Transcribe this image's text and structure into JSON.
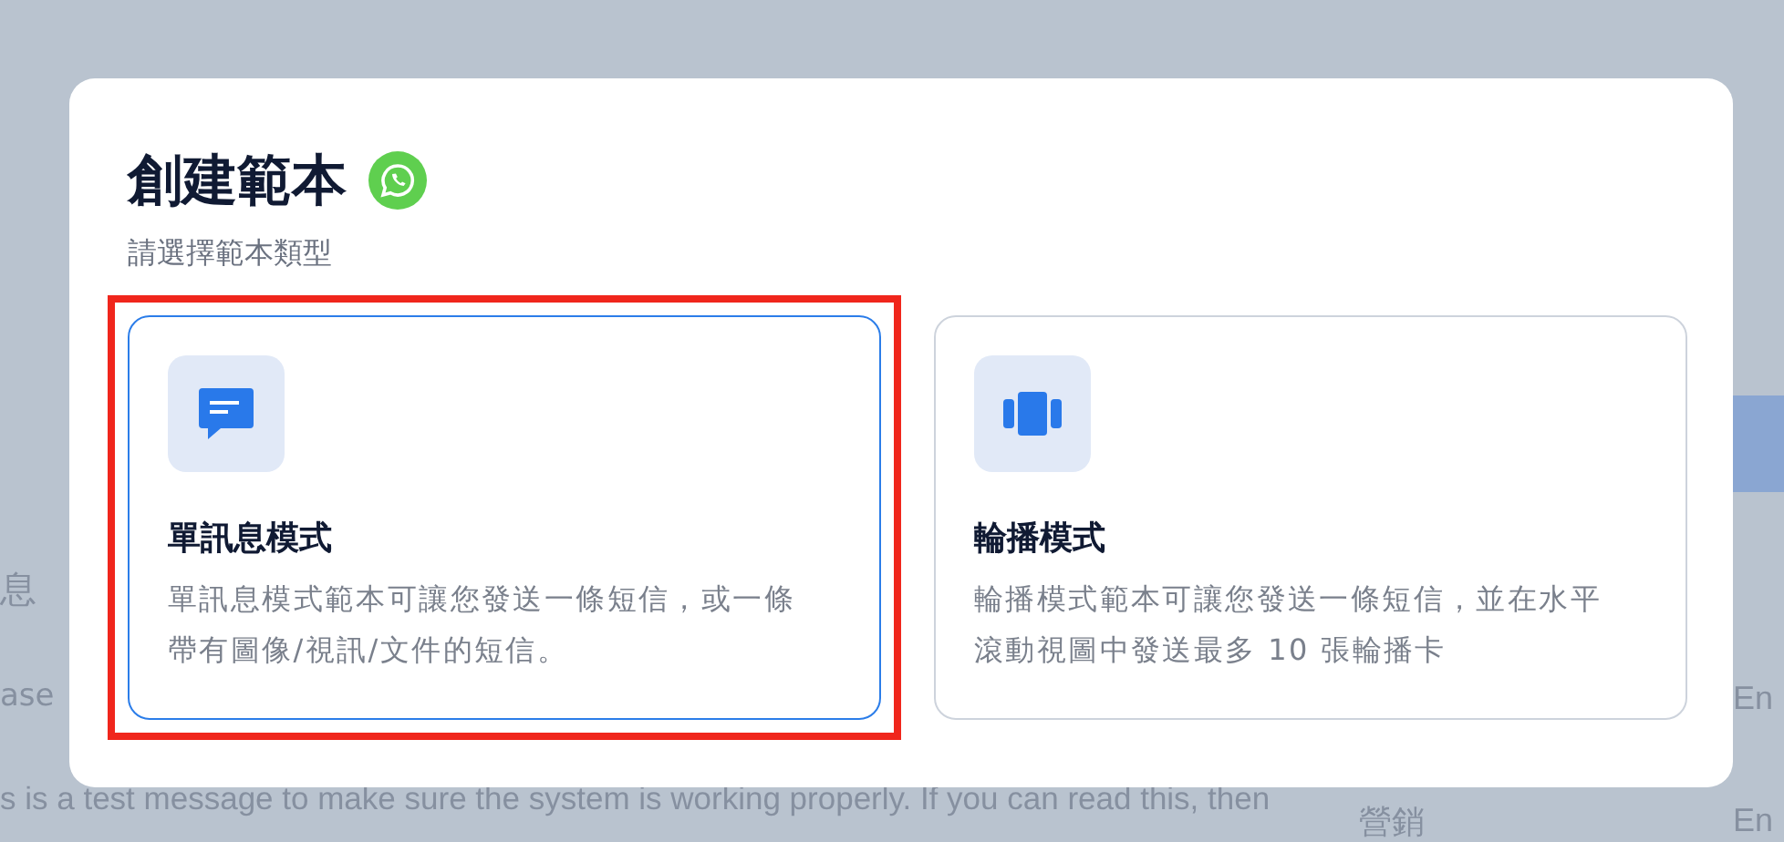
{
  "background": {
    "left_texts": [
      "息",
      "ase",
      "s is a test message to make sure the system is working properly. If you can read this, then"
    ],
    "category": "營銷",
    "languages": [
      "En",
      "En"
    ]
  },
  "dialog": {
    "title": "創建範本",
    "subtitle": "請選擇範本類型",
    "options": [
      {
        "kind": "single",
        "title": "單訊息模式",
        "description": "單訊息模式範本可讓您發送一條短信，或一條帶有圖像/視訊/文件的短信。",
        "selected": true,
        "highlighted": true
      },
      {
        "kind": "carousel",
        "title": "輪播模式",
        "description": "輪播模式範本可讓您發送一條短信，並在水平滾動視圖中發送最多 10 張輪播卡",
        "selected": false,
        "highlighted": false
      }
    ]
  }
}
